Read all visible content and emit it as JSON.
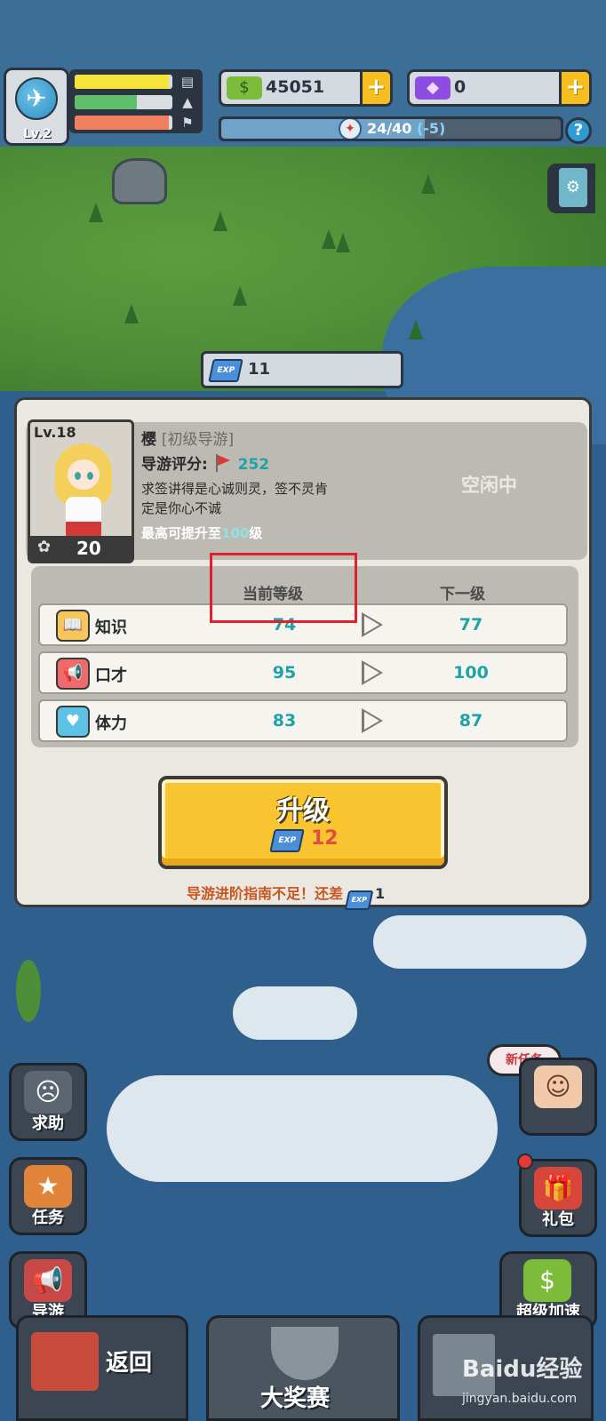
{
  "hud": {
    "player_level": "Lv.2",
    "bars": [
      {
        "color": "#f4e43a",
        "fill_percent": 96,
        "icon": "bus-icon"
      },
      {
        "color": "#5fbf6a",
        "fill_percent": 64,
        "icon": "mountain-icon"
      },
      {
        "color": "#f08060",
        "fill_percent": 96,
        "icon": "flag-icon"
      }
    ],
    "money": "45051",
    "gems": "0",
    "exploration": {
      "current": "24",
      "max": "40",
      "delta": "(-5)",
      "separator": "/"
    },
    "exp_books": "11"
  },
  "guide": {
    "level": "Lv.18",
    "stars": "20",
    "name": "樱",
    "title": "[初级导游]",
    "rating_label": "导游评分:",
    "rating_value": "252",
    "quote_line1": "求签讲得是心诚则灵，签不灵肯",
    "quote_line2": "定是你心不诚",
    "max_prefix": "最高可提升至",
    "max_value": "100",
    "max_suffix": "级",
    "status": "空闲中"
  },
  "table": {
    "col_current": "当前等级",
    "col_next": "下一级",
    "rows": [
      {
        "icon": "book-icon",
        "name": "知识",
        "current": "74",
        "next": "77"
      },
      {
        "icon": "megaphone-icon",
        "name": "口才",
        "current": "95",
        "next": "100"
      },
      {
        "icon": "heart-pulse-icon",
        "name": "体力",
        "current": "83",
        "next": "87"
      }
    ]
  },
  "upgrade": {
    "label": "升级",
    "cost": "12",
    "book_tag": "EXP"
  },
  "warning": {
    "text": "导游进阶指南不足！还差",
    "need": "1"
  },
  "side_buttons": {
    "help": "求助",
    "tasks": "任务",
    "guides": "导游",
    "new_task": "新任务",
    "gift": "礼包",
    "speedup": "超级加速"
  },
  "bottom": {
    "back": "返回",
    "contest": "大奖赛"
  },
  "watermark": {
    "brand": "Baidu经验",
    "url": "jingyan.baidu.com"
  },
  "colors": {
    "teal_value": "#1fa3a6",
    "upgrade_yellow": "#f8c530",
    "highlight_red": "#e0202a"
  }
}
